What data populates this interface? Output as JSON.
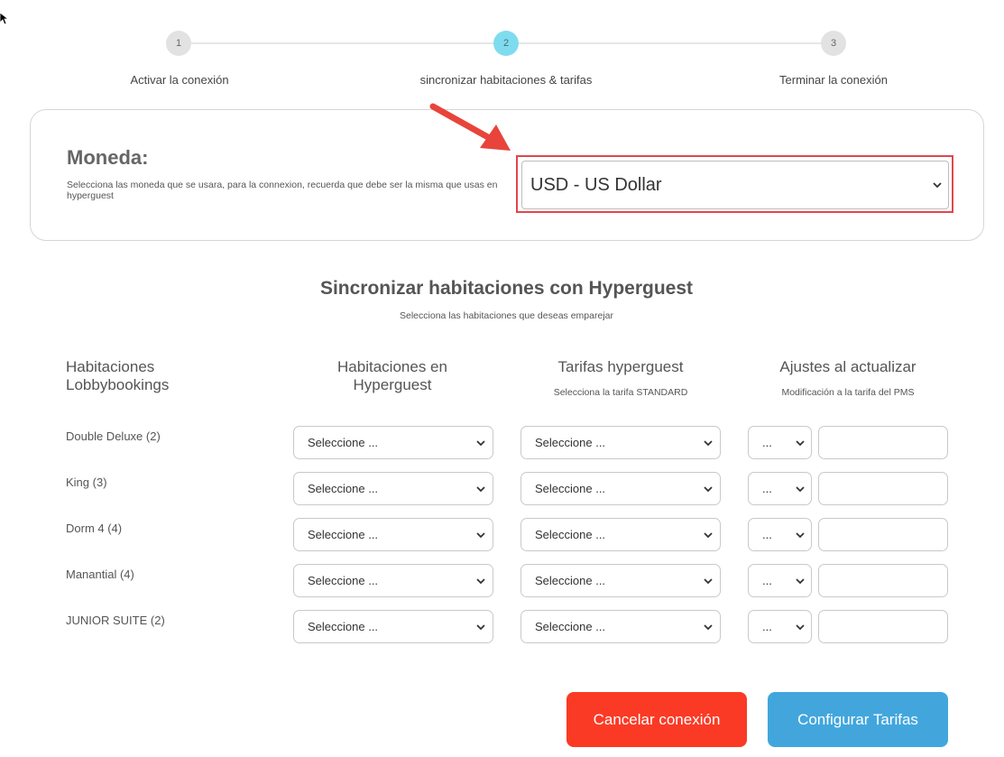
{
  "stepper": {
    "steps": [
      {
        "number": "1",
        "label": "Activar la conexión"
      },
      {
        "number": "2",
        "label": "sincronizar habitaciones & tarifas"
      },
      {
        "number": "3",
        "label": "Terminar la conexión"
      }
    ],
    "active_color": "#7fdcef"
  },
  "currency": {
    "title": "Moneda:",
    "help": "Selecciona las moneda que se usara, para la connexion, recuerda que debe ser la misma que usas en hyperguest",
    "selected": "USD - US Dollar",
    "highlight_color": "#e0464d"
  },
  "sync": {
    "title": "Sincronizar habitaciones con Hyperguest",
    "subtitle": "Selecciona las habitaciones que deseas emparejar"
  },
  "columns": {
    "col1": "Habitaciones Lobbybookings",
    "col2": "Habitaciones en Hyperguest",
    "col3": "Tarifas hyperguest",
    "col3_sub": "Selecciona la tarifa STANDARD",
    "col4": "Ajustes al actualizar",
    "col4_sub": "Modificación a la tarifa del PMS"
  },
  "rows": [
    {
      "room": "Double Deluxe (2)",
      "hotel_select": "Seleccione ...",
      "rate_select": "Seleccione ...",
      "adjust_select": "..."
    },
    {
      "room": "King (3)",
      "hotel_select": "Seleccione ...",
      "rate_select": "Seleccione ...",
      "adjust_select": "..."
    },
    {
      "room": "Dorm 4 (4)",
      "hotel_select": "Seleccione ...",
      "rate_select": "Seleccione ...",
      "adjust_select": "..."
    },
    {
      "room": "Manantial (4)",
      "hotel_select": "Seleccione ...",
      "rate_select": "Seleccione ...",
      "adjust_select": "..."
    },
    {
      "room": "JUNIOR SUITE (2)",
      "hotel_select": "Seleccione ...",
      "rate_select": "Seleccione ...",
      "adjust_select": "..."
    }
  ],
  "buttons": {
    "cancel": "Cancelar conexión",
    "configure": "Configurar Tarifas",
    "cancel_color": "#fb3a25",
    "configure_color": "#42a6dd"
  }
}
